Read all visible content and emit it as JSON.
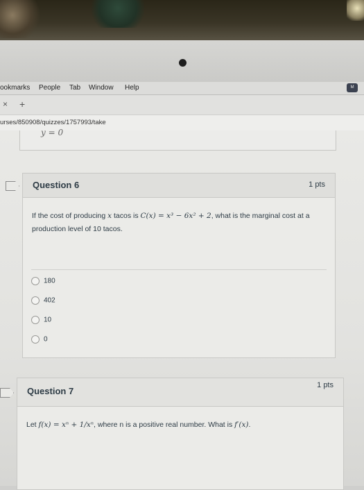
{
  "menubar": {
    "items": [
      "ookmarks",
      "People",
      "Tab",
      "Window",
      "Help"
    ]
  },
  "tabbar": {
    "close": "×",
    "new_tab": "+"
  },
  "url": "urses/850908/quizzes/1757993/take",
  "previous_answer": "y = 0",
  "questions": [
    {
      "title": "Question 6",
      "points": "1 pts",
      "text_before": "If the cost of producing ",
      "math_var": "x",
      "text_mid": " tacos is ",
      "math_expr": "C(x) = x³ − 6x² + 2",
      "text_after": ", what is the marginal cost at a production level of 10 tacos.",
      "options": [
        "180",
        "402",
        "10",
        "0"
      ]
    },
    {
      "title": "Question 7",
      "points": "1 pts",
      "text_before": "Let ",
      "math_expr": "f(x) = xⁿ + 1/xⁿ",
      "text_mid": ", where n is a positive real number. What is ",
      "math_expr2": "f′(x)",
      "text_after": "."
    }
  ]
}
